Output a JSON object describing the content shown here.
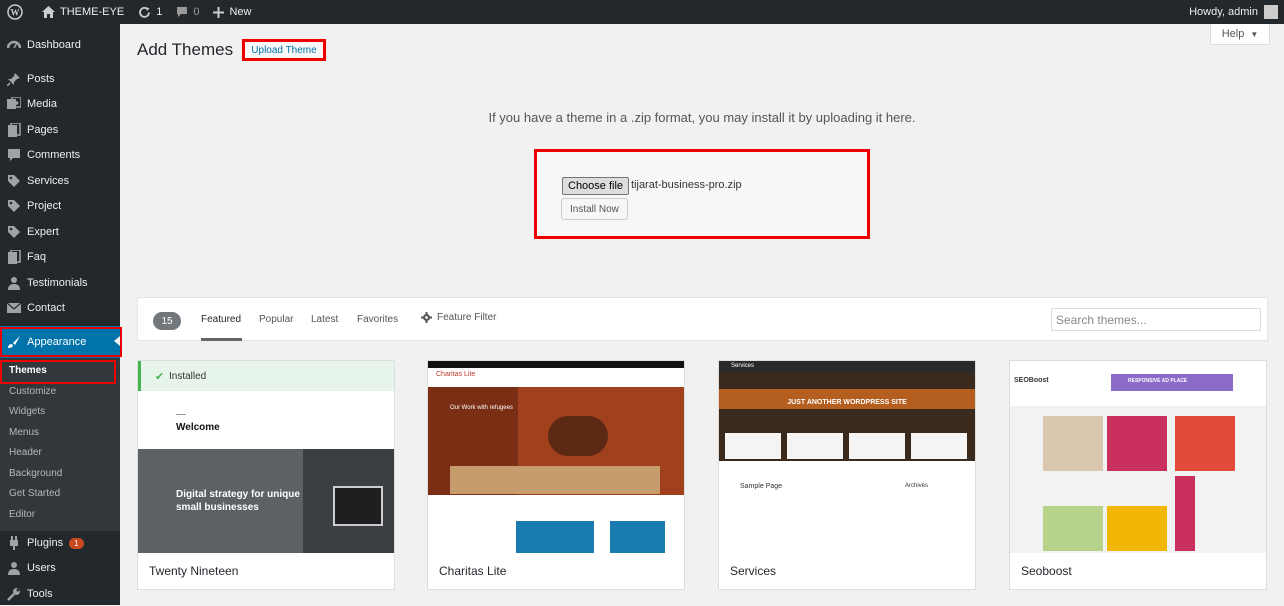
{
  "adminbar": {
    "site_name": "THEME-EYE",
    "updates_count": "1",
    "comments_count": "0",
    "new_label": "New",
    "howdy": "Howdy, admin"
  },
  "sidebar": {
    "items": [
      {
        "label": "Dashboard",
        "icon": "dashboard-icon"
      },
      {
        "label": "Posts",
        "icon": "pin-icon"
      },
      {
        "label": "Media",
        "icon": "media-icon"
      },
      {
        "label": "Pages",
        "icon": "pages-icon"
      },
      {
        "label": "Comments",
        "icon": "comment-icon"
      },
      {
        "label": "Services",
        "icon": "tag-icon"
      },
      {
        "label": "Project",
        "icon": "tag-icon"
      },
      {
        "label": "Expert",
        "icon": "tag-icon"
      },
      {
        "label": "Faq",
        "icon": "pages-icon"
      },
      {
        "label": "Testimonials",
        "icon": "users-icon"
      },
      {
        "label": "Contact",
        "icon": "mail-icon"
      },
      {
        "label": "Appearance",
        "icon": "brush-icon"
      },
      {
        "label": "Plugins",
        "icon": "plugin-icon",
        "badge": "1"
      },
      {
        "label": "Users",
        "icon": "user-icon"
      },
      {
        "label": "Tools",
        "icon": "wrench-icon"
      }
    ],
    "submenu": [
      "Themes",
      "Customize",
      "Widgets",
      "Menus",
      "Header",
      "Background",
      "Get Started",
      "Editor"
    ]
  },
  "header": {
    "title": "Add Themes",
    "upload_button": "Upload Theme",
    "help": "Help"
  },
  "upload": {
    "description": "If you have a theme in a .zip format, you may install it by uploading it here.",
    "choose_file": "Choose file",
    "file_name": "tijarat-business-pro.zip",
    "install_button": "Install Now"
  },
  "filter": {
    "count": "15",
    "tabs": [
      "Featured",
      "Popular",
      "Latest",
      "Favorites"
    ],
    "feature_filter": "Feature Filter",
    "search_placeholder": "Search themes..."
  },
  "themes": [
    {
      "name": "Twenty Nineteen",
      "installed_label": "Installed",
      "welcome": "Welcome",
      "headline": "Digital strategy for unique small businesses"
    },
    {
      "name": "Charitas Lite",
      "shot_logo": "Charitas Lite",
      "shot_tagline": "Our Work with refugees"
    },
    {
      "name": "Services",
      "shot_logo": "Services",
      "shot_headline": "JUST ANOTHER WORDPRESS SITE",
      "shot_sample": "Sample Page",
      "shot_archives": "Archives"
    },
    {
      "name": "Seoboost",
      "shot_logo": "SEOBoost",
      "shot_banner": "RESPONSIVE AD PLACE"
    }
  ],
  "colors": {
    "accent": "#0073aa",
    "admin_dark": "#23282d",
    "highlight_red": "#e00000"
  }
}
